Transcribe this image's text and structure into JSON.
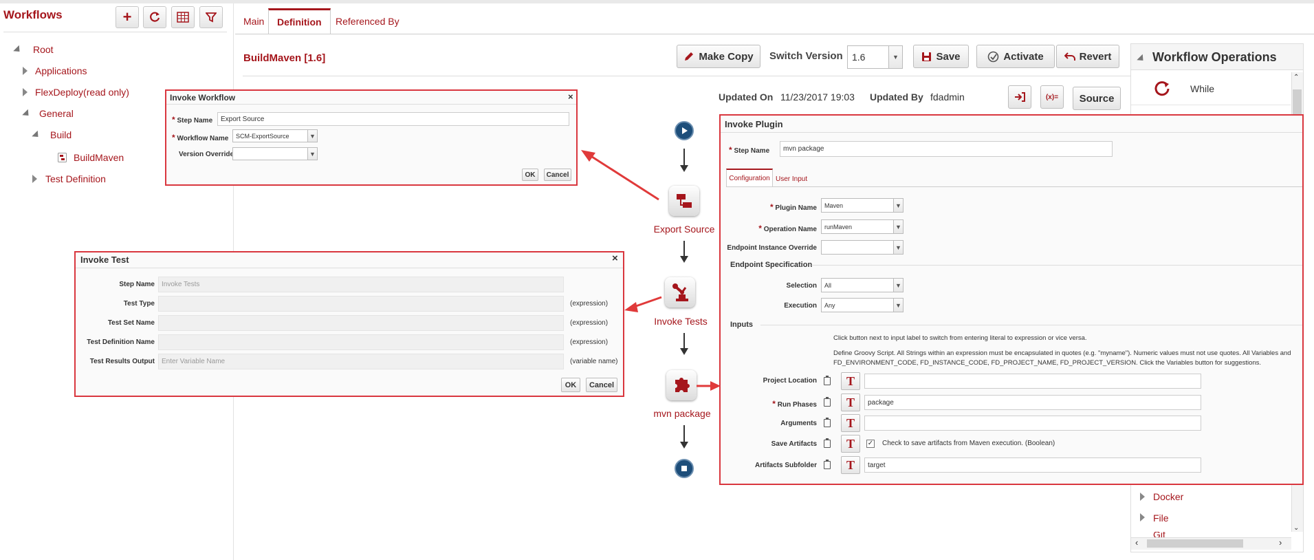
{
  "sidebar": {
    "title": "Workflows",
    "tree": {
      "root": "Root",
      "applications": "Applications",
      "flexdeploy": "FlexDeploy(read only)",
      "general": "General",
      "build": "Build",
      "buildmaven": "BuildMaven",
      "test_definition": "Test Definition"
    }
  },
  "tabs": {
    "main": "Main",
    "definition": "Definition",
    "referenced_by": "Referenced By"
  },
  "header": {
    "workflow_title": "BuildMaven [1.6]",
    "make_copy": "Make Copy",
    "switch_version_label": "Switch Version",
    "version": "1.6",
    "save": "Save",
    "activate": "Activate",
    "revert": "Revert",
    "updated_on_label": "Updated On",
    "updated_on": "11/23/2017 19:03",
    "updated_by_label": "Updated By",
    "updated_by": "fdadmin",
    "source": "Source",
    "var_icon": "(x)="
  },
  "operations": {
    "title": "Workflow Operations",
    "while": "While",
    "docker": "Docker",
    "file": "File",
    "git": "Git"
  },
  "flow": {
    "export_source": "Export Source",
    "invoke_tests": "Invoke Tests",
    "mvn_package": "mvn package"
  },
  "invoke_workflow": {
    "title": "Invoke Workflow",
    "step_name_label": "Step Name",
    "step_name": "Export Source",
    "workflow_name_label": "Workflow Name",
    "workflow_name": "SCM-ExportSource",
    "version_override_label": "Version Override",
    "ok": "OK",
    "cancel": "Cancel"
  },
  "invoke_test": {
    "title": "Invoke Test",
    "step_name_label": "Step Name",
    "step_name": "Invoke Tests",
    "test_type_label": "Test Type",
    "test_set_label": "Test Set Name",
    "test_def_label": "Test Definition Name",
    "test_results_label": "Test Results Output",
    "test_results_placeholder": "Enter Variable Name",
    "expression": "(expression)",
    "variable_name": "(variable name)",
    "ok": "OK",
    "cancel": "Cancel"
  },
  "invoke_plugin": {
    "title": "Invoke Plugin",
    "step_name_label": "Step Name",
    "step_name": "mvn package",
    "tab_configuration": "Configuration",
    "tab_user_input": "User Input",
    "plugin_name_label": "Plugin Name",
    "plugin_name": "Maven",
    "operation_name_label": "Operation Name",
    "operation_name": "runMaven",
    "endpoint_override_label": "Endpoint Instance Override",
    "endpoint_spec": "Endpoint Specification",
    "selection_label": "Selection",
    "selection": "All",
    "execution_label": "Execution",
    "execution": "Any",
    "inputs": "Inputs",
    "hint1": "Click button next to input label to switch from entering literal to expression or vice versa.",
    "hint2a": "Define Groovy Script. All Strings within an expression must be encapsulated in quotes (e.g. \"myname\"). Numeric values must not use quotes. All Variables and",
    "hint2b": "FD_ENVIRONMENT_CODE, FD_INSTANCE_CODE, FD_PROJECT_NAME, FD_PROJECT_VERSION. Click the Variables button for suggestions.",
    "project_location_label": "Project Location",
    "run_phases_label": "Run Phases",
    "run_phases": "package",
    "arguments_label": "Arguments",
    "save_artifacts_label": "Save Artifacts",
    "save_artifacts_text": "Check to save artifacts from Maven execution. (Boolean)",
    "artifacts_subfolder_label": "Artifacts Subfolder",
    "artifacts_subfolder": "target",
    "t": "T"
  }
}
